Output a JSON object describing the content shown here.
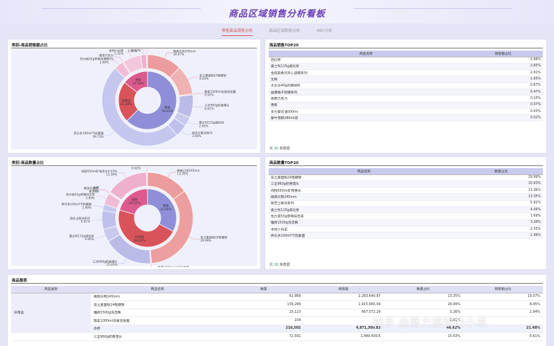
{
  "page": {
    "title": "商品区域销售分析看板"
  },
  "tabs": [
    {
      "label": "零售商品销售分析",
      "active": true
    },
    {
      "label": "商品区域销售分析",
      "active": false
    },
    {
      "label": "ABC分析",
      "active": false
    }
  ],
  "sales_donut": {
    "title": "类别-商品销售额占比",
    "inner": [
      {
        "name": "零食",
        "value": "58.61%",
        "color": "#8f8fd9"
      },
      {
        "name": "日用品",
        "value": "21.48%",
        "color": "#d9545a"
      },
      {
        "name": "生鲜",
        "value": "13.54%",
        "color": "#dd5a8e"
      }
    ],
    "outer": [
      {
        "name": "微爽日用245mm",
        "value": "10.07%",
        "color": "#ec9c9c"
      },
      {
        "name": "安之素面粉24卷硬架",
        "value": "8.45%",
        "color": "#f0b2b2"
      },
      {
        "name": "飘柔1000ml去屑洗发露",
        "value": "0.02%",
        "color": "#ed9f9f"
      },
      {
        "name": "三全960g奶香馒头",
        "value": "6.61%",
        "color": "#bbbbe8"
      },
      {
        "name": "嘉士利115g威化饼",
        "value": "2.65%",
        "color": "#c9c9ee"
      },
      {
        "name": "丽芝士歌派系列",
        "value": "3.60%",
        "color": "#bfc0ec"
      },
      {
        "name": "养乐多100ml*5乳酸菌",
        "value": "39.73%",
        "color": "#c6c7ef"
      },
      {
        "name": "怡力高55g草莓味吉奇",
        "value": "2.69%",
        "color": "#f0bcd5"
      },
      {
        "name": "德芙巧克力",
        "value": "0.15%",
        "color": "#e9a4c4"
      },
      {
        "name": "本地小白菜",
        "value": "5.31%",
        "color": "#f4c8dc"
      },
      {
        "name": "生鲜",
        "value": "1.65%",
        "color": "#eeb0cd"
      },
      {
        "name": "蒙牛雪糕280ml袋",
        "value": "0.02%",
        "color": "#f2bcd3"
      }
    ]
  },
  "qty_donut": {
    "title": "类别-商品数量占比",
    "inner": [
      {
        "name": "零食",
        "value": "32.66%",
        "color": "#8f8fd9"
      },
      {
        "name": "日用品",
        "value": "46.82%",
        "color": "#d9545a"
      },
      {
        "name": "生鲜",
        "value": "20.52%",
        "color": "#dd5a8e"
      }
    ],
    "outer": [
      {
        "name": "微爽日用245mm",
        "value": "13.35%",
        "color": "#ec9c9c"
      },
      {
        "name": "安之素面粉24卷硬架",
        "value": "29.99%",
        "color": "#ed9f9f"
      },
      {
        "name": "飘柔1000ml去屑洗发露",
        "value": "0.02%",
        "color": "#f0b2b2"
      },
      {
        "name": "三全960g奶香馒头",
        "value": "15.63%",
        "color": "#bbbbe8"
      },
      {
        "name": "嘉士利115g威化饼",
        "value": "4.06%",
        "color": "#c9c9ee"
      },
      {
        "name": "丽芝士歌派系列",
        "value": "5.91%",
        "color": "#bfc0ec"
      },
      {
        "name": "养乐多100ml*5乳酸菌",
        "value": "1.99%",
        "color": "#c6c7ef"
      },
      {
        "name": "怡力高55g草莓味吉奇",
        "value": "3.69%",
        "color": "#f0bcd5"
      },
      {
        "name": "德芙巧克力",
        "value": "0.23%",
        "color": "#e9a4c4"
      },
      {
        "name": "香蕉",
        "value": "0.00%",
        "color": "#f4c8dc"
      },
      {
        "name": "纯悦550ml矿物质水0.03%",
        "value": "13.36%",
        "color": "#eeb0cd"
      },
      {
        "name": "蒙牛雪糕280ml袋",
        "value": "0.02%",
        "color": "#f2bcd3"
      }
    ]
  },
  "top_sales": {
    "title": "商品销售TOP20",
    "headers": [
      "商品名称",
      "销售额占比"
    ],
    "rows": [
      [
        "西红柿",
        "2.66%"
      ],
      [
        "嘉士利115g威化饼",
        "2.65%"
      ],
      [
        "金冠森香浓夹心蛋糕系列",
        "2.61%"
      ],
      [
        "生鲜",
        "1.65%"
      ],
      [
        "太太乐40g鸡精味料",
        "0.67%"
      ],
      [
        "益康橘子软糖系列",
        "0.47%"
      ],
      [
        "德芙巧克力",
        "0.15%"
      ],
      [
        "香蕉",
        "0.07%"
      ],
      [
        "多力葵花油500ml",
        "0.03%"
      ],
      [
        "蒙牛雪糕280ml袋",
        "0.02%"
      ]
    ],
    "footer_pre": "共",
    "footer_num": "20",
    "footer_post": "条数据"
  },
  "top_qty": {
    "title": "商品数量TOP20",
    "headers": [
      "商品名称",
      "数量占比"
    ],
    "rows": [
      [
        "安之素面粉24卷硬架",
        "29.99%"
      ],
      [
        "三全960g奶香馒头",
        "15.63%"
      ],
      [
        "纯悦550ml矿物质水",
        "13.36%"
      ],
      [
        "微爽日用245mm",
        "13.35%"
      ],
      [
        "丽芝士歌派系列",
        "5.91%"
      ],
      [
        "嘉士利115g威化饼",
        "4.06%"
      ],
      [
        "怡力高55g草莓味吉奇",
        "3.69%"
      ],
      [
        "雕牌1500g洗洁精",
        "3.26%"
      ],
      [
        "本地小白菜",
        "2.55%"
      ],
      [
        "养乐多100ml*5乳酸菌",
        "1.99%"
      ]
    ],
    "footer_pre": "共",
    "footer_num": "20",
    "footer_post": "条数据"
  },
  "report": {
    "title": "商品报表",
    "headers": [
      "商品类别",
      "商品名称",
      "数量",
      "销售额",
      "数量占比",
      "销售额占比"
    ],
    "category": "日用品",
    "rows": [
      [
        "微爽日用245mm",
        "61,989",
        "2,283,640.87",
        "13.35%",
        "10.07%"
      ],
      [
        "安之素面粉24卷硬架",
        "139,286",
        "1,915,665.04",
        "29.99%",
        "8.45%"
      ],
      [
        "雕牌1500g洗洁精",
        "15,123",
        "667,572.29",
        "3.26%",
        "2.94%"
      ],
      [
        "飘柔1000ml去屑洗发露",
        "104",
        "",
        "0.02%",
        ""
      ]
    ],
    "subtotal": [
      "小计",
      "216,502",
      "4,871,300.82",
      "46.62%",
      "21.48%"
    ],
    "next_row": [
      "三全960g奶香馒头",
      "72,591",
      "1,499,439.6",
      "15.63%",
      "6.61%"
    ]
  },
  "watermark": "知乎 @努力搞钱的小羊"
}
